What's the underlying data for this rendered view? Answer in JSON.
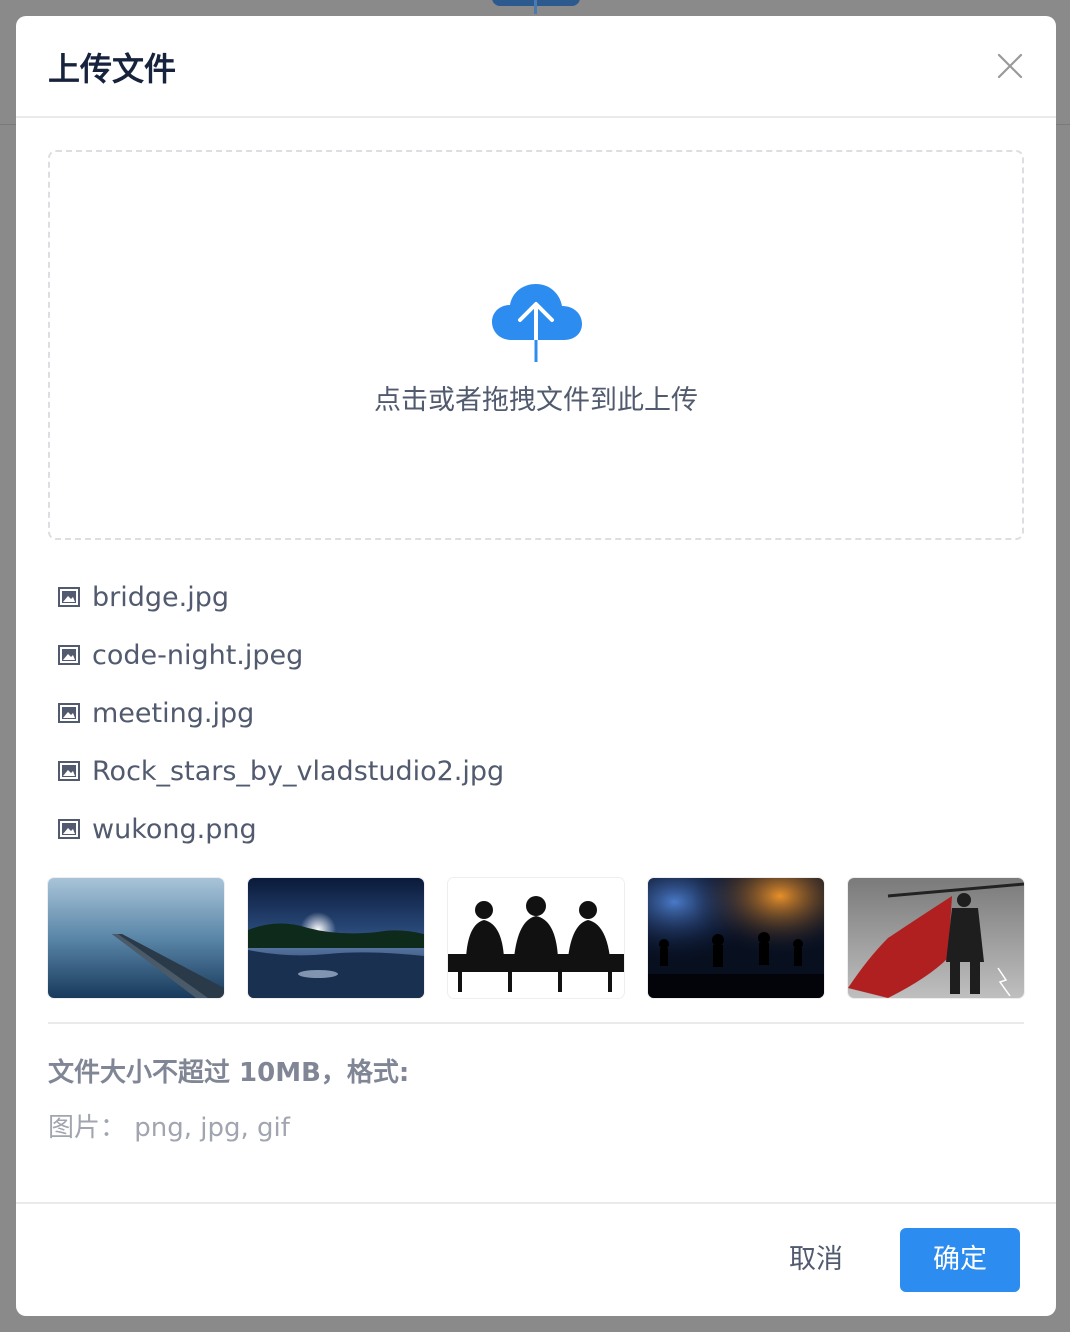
{
  "modal": {
    "title": "上传文件",
    "close_icon": "close-icon"
  },
  "dropzone": {
    "icon": "cloud-upload-icon",
    "text": "点击或者拖拽文件到此上传",
    "accent_color": "#2d8cf0"
  },
  "files": [
    {
      "name": "bridge.jpg",
      "icon": "image-file-icon"
    },
    {
      "name": "code-night.jpeg",
      "icon": "image-file-icon"
    },
    {
      "name": "meeting.jpg",
      "icon": "image-file-icon"
    },
    {
      "name": "Rock_stars_by_vladstudio2.jpg",
      "icon": "image-file-icon"
    },
    {
      "name": "wukong.png",
      "icon": "image-file-icon"
    }
  ],
  "previews": [
    "bridge",
    "code-night",
    "meeting",
    "rock-stars",
    "wukong"
  ],
  "hint": {
    "title": "文件大小不超过 10MB，格式:",
    "formats": "图片：  png, jpg, gif"
  },
  "footer": {
    "cancel_label": "取消",
    "ok_label": "确定",
    "primary_color": "#2d8cf0"
  }
}
